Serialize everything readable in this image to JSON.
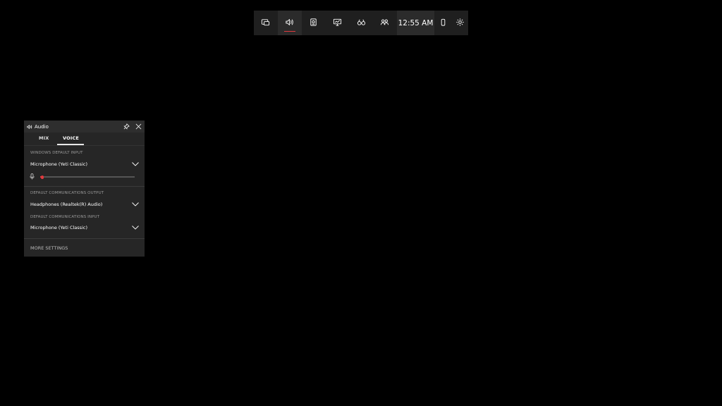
{
  "gamebar": {
    "buttons": [
      {
        "icon": "widget-menu-icon",
        "active": false
      },
      {
        "icon": "audio-icon",
        "active": true
      },
      {
        "icon": "capture-icon",
        "active": false
      },
      {
        "icon": "performance-icon",
        "active": false
      },
      {
        "icon": "looking-for-group-icon",
        "active": false
      },
      {
        "icon": "xbox-social-icon",
        "active": false
      }
    ],
    "time": "12:55 AM",
    "accent_color": "#e03a3e"
  },
  "audio_widget": {
    "title": "Audio",
    "tabs": [
      {
        "label": "MIX",
        "active": false
      },
      {
        "label": "VOICE",
        "active": true
      }
    ],
    "windows_default_input": {
      "label": "WINDOWS DEFAULT INPUT",
      "value": "Microphone (Yeti Classic)",
      "level_fraction": 0.02
    },
    "default_communications_output": {
      "label": "DEFAULT COMMUNICATIONS OUTPUT",
      "value": "Headphones (Realtek(R) Audio)"
    },
    "default_communications_input": {
      "label": "DEFAULT COMMUNICATIONS INPUT",
      "value": "Microphone (Yeti Classic)"
    },
    "more_settings": "MORE SETTINGS"
  }
}
